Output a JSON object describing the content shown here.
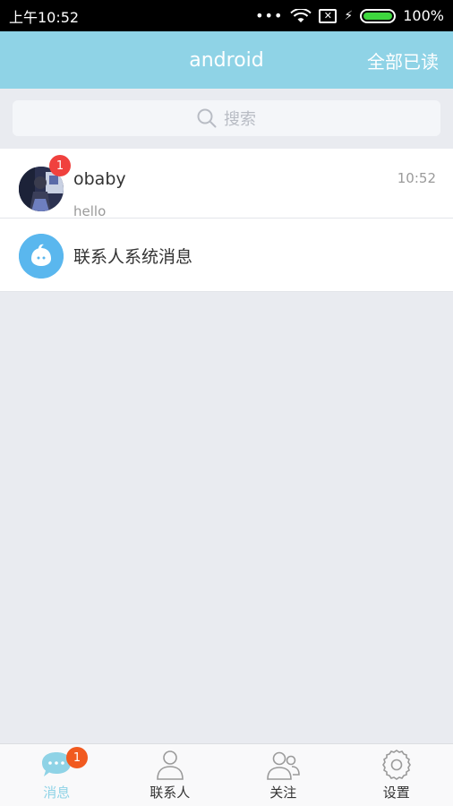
{
  "status_bar": {
    "time": "上午10:52",
    "dots": "•••",
    "sim": "✕",
    "battery": "100%"
  },
  "header": {
    "title": "android",
    "mark_all_read": "全部已读"
  },
  "search": {
    "placeholder": "搜索"
  },
  "conversations": [
    {
      "name": "obaby",
      "preview": "hello",
      "time": "10:52",
      "unread": "1"
    },
    {
      "name": "联系人系统消息"
    }
  ],
  "bottom_nav": {
    "items": [
      {
        "label": "消息",
        "badge": "1"
      },
      {
        "label": "联系人"
      },
      {
        "label": "关注"
      },
      {
        "label": "设置"
      }
    ]
  },
  "colors": {
    "accent": "#8fd3e6",
    "badge_red": "#f0413e",
    "badge_orange": "#f15a1f"
  }
}
